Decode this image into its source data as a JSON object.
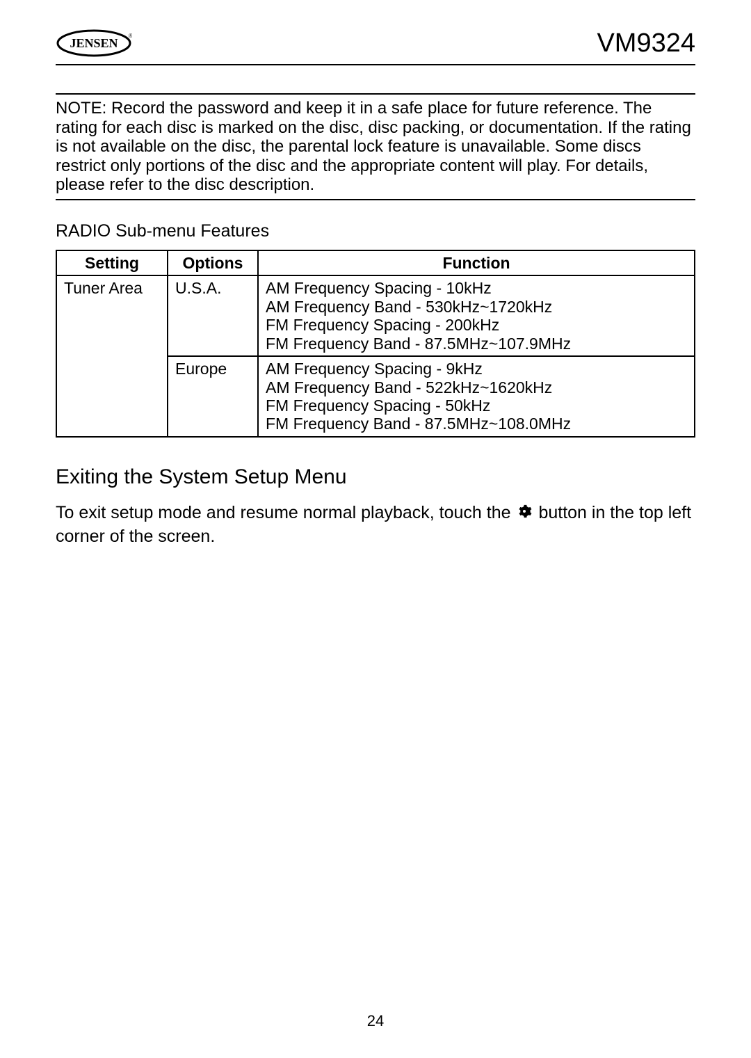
{
  "header": {
    "brand": "JENSEN",
    "model": "VM9324"
  },
  "note": {
    "text": "NOTE: Record the password and keep it in a safe place for future reference. The rating for each disc is marked on the disc, disc packing, or documentation. If the rating is not available on the disc, the parental lock feature is unavailable. Some discs restrict only portions of the disc and the appropriate content will play. For details, please refer to the disc description."
  },
  "radio_submenu": {
    "title": "RADIO Sub-menu Features",
    "headers": {
      "setting": "Setting",
      "options": "Options",
      "function": "Function"
    },
    "rows": [
      {
        "setting": "Tuner Area",
        "option": "U.S.A.",
        "functions": [
          "AM Frequency Spacing - 10kHz",
          "AM Frequency Band - 530kHz~1720kHz",
          "FM Frequency Spacing - 200kHz",
          "FM Frequency Band - 87.5MHz~107.9MHz"
        ]
      },
      {
        "setting": "",
        "option": "Europe",
        "functions": [
          "AM Frequency Spacing - 9kHz",
          "AM Frequency Band - 522kHz~1620kHz",
          "FM Frequency Spacing - 50kHz",
          "FM Frequency Band - 87.5MHz~108.0MHz"
        ]
      }
    ]
  },
  "exit_section": {
    "title": "Exiting the System Setup Menu",
    "text_before": "To exit setup mode and resume normal playback, touch the ",
    "text_after": " button in the top left corner of the screen."
  },
  "page_number": "24"
}
